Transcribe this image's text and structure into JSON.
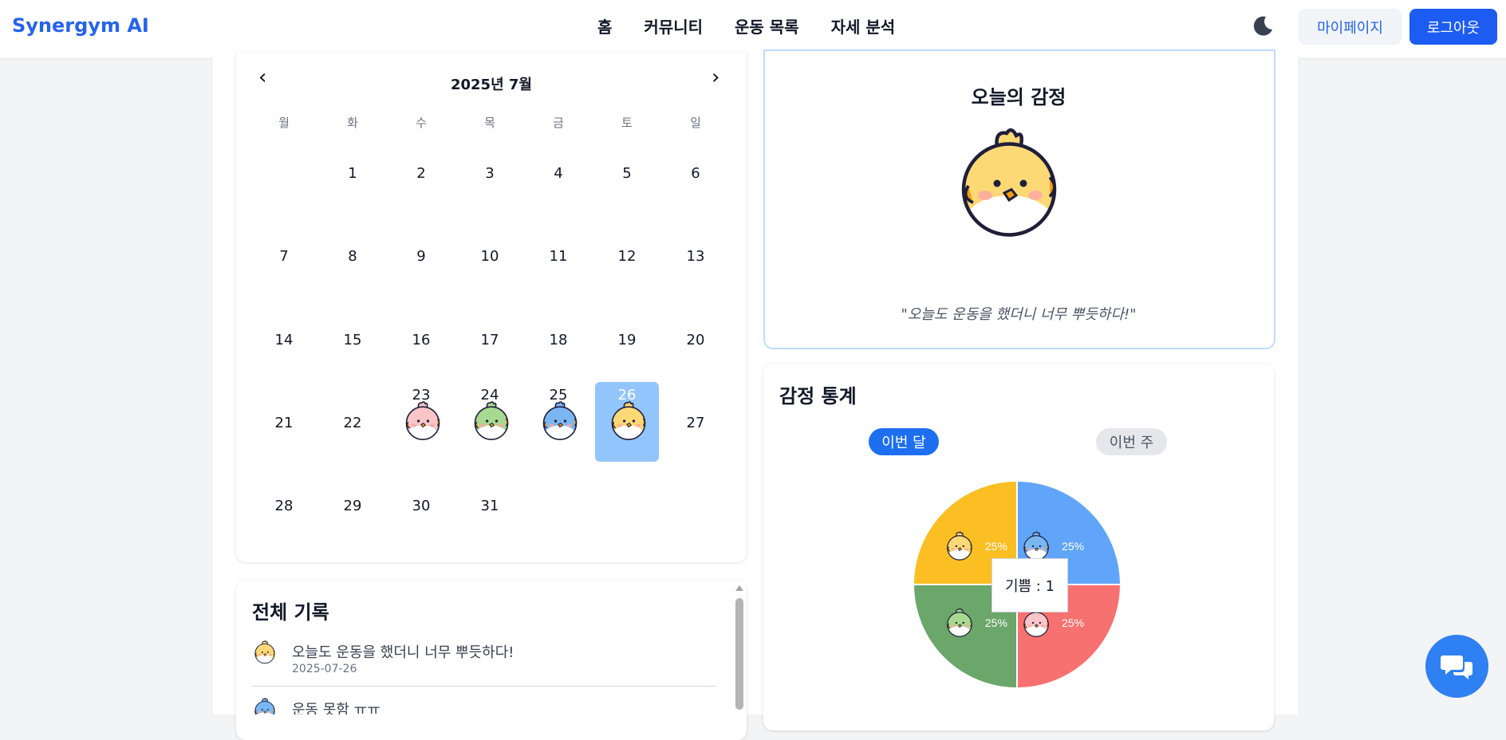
{
  "header": {
    "brand": "Synergym AI",
    "nav": [
      "홈",
      "커뮤니티",
      "운동 목록",
      "자세 분석"
    ],
    "theme_icon": "moon-icon",
    "mypage_label": "마이페이지",
    "logout_label": "로그아웃"
  },
  "calendar": {
    "month_title": "2025년 7월",
    "prev_icon": "chevron-left-icon",
    "next_icon": "chevron-right-icon",
    "weekdays": [
      "월",
      "화",
      "수",
      "목",
      "금",
      "토",
      "일"
    ],
    "first_weekday_index": 1,
    "days_in_month": 31,
    "selected_day": 26,
    "emotion_days": [
      {
        "day": 23,
        "emotion": "pink"
      },
      {
        "day": 24,
        "emotion": "green"
      },
      {
        "day": 25,
        "emotion": "blue"
      },
      {
        "day": 26,
        "emotion": "yellow"
      }
    ]
  },
  "history": {
    "title": "전체 기록",
    "items": [
      {
        "text": "오늘도 운동을 했더니 너무 뿌듯하다!",
        "date": "2025-07-26",
        "emotion": "yellow"
      },
      {
        "text": "운동 못함 ㅠㅠ",
        "date": "",
        "emotion": "blue"
      }
    ]
  },
  "today": {
    "title": "오늘의 감정",
    "emotion": "yellow",
    "quote": "\"오늘도 운동을 했더니 너무 뿌듯하다!\""
  },
  "stats": {
    "title": "감정 통계",
    "tab_month": "이번 달",
    "tab_week": "이번 주",
    "active_tab": "이번 달",
    "tooltip": "기쁨 : 1"
  },
  "colors": {
    "brand": "#2563eb",
    "yellow": "#fbbf24",
    "blue": "#60a5fa",
    "red": "#f87171",
    "green": "#6ba66b",
    "pink": "#f9c5c9",
    "light_green": "#a8d990",
    "light_blue": "#7ab7f2",
    "face_yellow": "#fdd976"
  },
  "chart_data": {
    "type": "pie",
    "slices": [
      {
        "emotion": "blue",
        "value": 1,
        "label": "25%"
      },
      {
        "emotion": "red",
        "value": 1,
        "label": "25%"
      },
      {
        "emotion": "green",
        "value": 1,
        "label": "25%"
      },
      {
        "emotion": "yellow",
        "value": 1,
        "label": "25%"
      }
    ]
  },
  "chat": {
    "icon": "chat-icon"
  }
}
